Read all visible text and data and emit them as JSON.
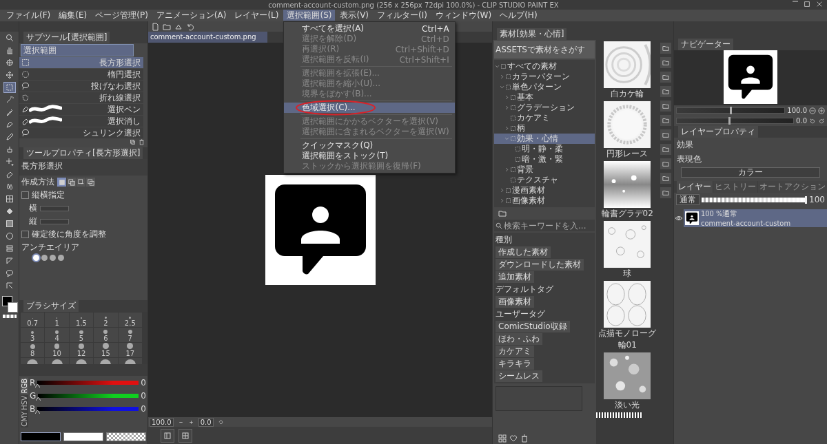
{
  "window": {
    "title": "comment-account-custom.png (256 x 256px 72dpi 100.0%) - CLIP STUDIO PAINT EX"
  },
  "menu_bar": [
    {
      "label": "ファイル(F)",
      "selected": false
    },
    {
      "label": "編集(E)",
      "selected": false
    },
    {
      "label": "ページ管理(P)",
      "selected": false
    },
    {
      "label": "アニメーション(A)",
      "selected": false
    },
    {
      "label": "レイヤー(L)",
      "selected": false
    },
    {
      "label": "選択範囲(S)",
      "selected": true
    },
    {
      "label": "表示(V)",
      "selected": false
    },
    {
      "label": "フィルター(I)",
      "selected": false
    },
    {
      "label": "ウィンドウ(W)",
      "selected": false
    },
    {
      "label": "ヘルプ(H)",
      "selected": false
    }
  ],
  "selection_menu": [
    {
      "kind": "item",
      "label": "すべてを選択(A)",
      "shortcut": "Ctrl+A",
      "disabled": false,
      "selected": false,
      "circled": false
    },
    {
      "kind": "item",
      "label": "選択を解除(D)",
      "shortcut": "Ctrl+D",
      "disabled": true,
      "selected": false,
      "circled": false
    },
    {
      "kind": "item",
      "label": "再選択(R)",
      "shortcut": "Ctrl+Shift+D",
      "disabled": true,
      "selected": false,
      "circled": false
    },
    {
      "kind": "item",
      "label": "選択範囲を反転(I)",
      "shortcut": "Ctrl+Shift+I",
      "disabled": true,
      "selected": false,
      "circled": false
    },
    {
      "kind": "separator"
    },
    {
      "kind": "item",
      "label": "選択範囲を拡張(E)...",
      "disabled": true,
      "selected": false,
      "circled": false
    },
    {
      "kind": "item",
      "label": "選択範囲を縮小(U)...",
      "disabled": true,
      "selected": false,
      "circled": false
    },
    {
      "kind": "item",
      "label": "境界をぼかす(B)...",
      "disabled": true,
      "selected": false,
      "circled": false
    },
    {
      "kind": "separator"
    },
    {
      "kind": "item",
      "label": "色域選択(C)...",
      "disabled": false,
      "selected": true,
      "circled": true
    },
    {
      "kind": "separator"
    },
    {
      "kind": "item",
      "label": "選択範囲にかかるベクターを選択(V)",
      "disabled": true,
      "selected": false,
      "circled": false
    },
    {
      "kind": "item",
      "label": "選択範囲に含まれるベクターを選択(W)",
      "disabled": true,
      "selected": false,
      "circled": false
    },
    {
      "kind": "separator"
    },
    {
      "kind": "item",
      "label": "クイックマスク(Q)",
      "disabled": false,
      "selected": false,
      "circled": false
    },
    {
      "kind": "item",
      "label": "選択範囲をストック(T)",
      "disabled": false,
      "selected": false,
      "circled": false
    },
    {
      "kind": "item",
      "label": "ストックから選択範囲を復帰(F)",
      "disabled": true,
      "selected": false,
      "circled": false
    }
  ],
  "tools": [
    {
      "kind": "zoom",
      "selected": false
    },
    {
      "kind": "hand",
      "selected": false
    },
    {
      "kind": "view",
      "selected": false
    },
    {
      "kind": "move",
      "selected": false
    },
    {
      "kind": "select",
      "selected": true
    },
    {
      "kind": "wand",
      "selected": false
    },
    {
      "kind": "eyedropper",
      "selected": false
    },
    {
      "kind": "pen",
      "selected": false
    },
    {
      "kind": "pencil",
      "selected": false
    },
    {
      "kind": "airbrush",
      "selected": false
    },
    {
      "kind": "decoration",
      "selected": false
    },
    {
      "kind": "eraser",
      "selected": false
    },
    {
      "kind": "blend",
      "selected": false
    },
    {
      "kind": "frame",
      "selected": false
    },
    {
      "kind": "fill",
      "selected": false
    },
    {
      "kind": "gradient",
      "selected": false
    },
    {
      "kind": "figure",
      "selected": false
    },
    {
      "kind": "layers",
      "selected": false
    },
    {
      "kind": "ruler",
      "selected": false
    },
    {
      "kind": "balloon",
      "selected": false
    },
    {
      "kind": "correction",
      "selected": false
    }
  ],
  "subtool": {
    "tab": "サブツール[選択範囲]",
    "group": "選択範囲",
    "items": [
      {
        "label": "長方形選択",
        "kind": "rect",
        "selected": true,
        "scribbled": false
      },
      {
        "label": "楕円選択",
        "kind": "ellipse",
        "selected": false,
        "scribbled": false
      },
      {
        "label": "投げなわ選択",
        "kind": "lasso",
        "selected": false,
        "scribbled": false
      },
      {
        "label": "折れ線選択",
        "kind": "polyline",
        "selected": false,
        "scribbled": false
      },
      {
        "label": "選択ペン",
        "kind": "pen",
        "selected": false,
        "scribbled": true
      },
      {
        "label": "選択消し",
        "kind": "eraser",
        "selected": false,
        "scribbled": true
      },
      {
        "label": "シュリンク選択",
        "kind": "lasso",
        "selected": false,
        "scribbled": false
      }
    ]
  },
  "tool_property": {
    "tab": "ツールプロパティ[長方形選択]",
    "title": "長方形選択",
    "creation_label": "作成方法",
    "creation_modes": [
      {
        "kind": "new",
        "selected": true
      },
      {
        "kind": "add",
        "selected": false
      },
      {
        "kind": "subtract",
        "selected": false
      },
      {
        "kind": "intersect",
        "selected": false
      }
    ],
    "aspect": {
      "label": "縦横指定",
      "checked": false
    },
    "width_label": "横",
    "height_label": "縦",
    "adjust_angle": {
      "label": "確定後に角度を調整",
      "checked": false
    },
    "antialias_label": "アンチエイリア",
    "antialias_levels": [
      {
        "selected": true
      },
      {
        "selected": false
      },
      {
        "selected": false
      },
      {
        "selected": false
      }
    ]
  },
  "brush_size": {
    "tab": "ブラシサイズ",
    "sizes": [
      "0.7",
      "1",
      "1.5",
      "2",
      "2.5",
      "3",
      "4",
      "5",
      "6",
      "7",
      "8",
      "10",
      "12",
      "15",
      "17"
    ]
  },
  "color_slider": {
    "modes": [
      {
        "label": "RGB",
        "selected": true
      },
      {
        "label": "HSV",
        "selected": false
      },
      {
        "label": "CMY",
        "selected": false
      }
    ],
    "channels": [
      {
        "name": "R",
        "color": "#e01010",
        "level": 0,
        "reading": "0"
      },
      {
        "name": "G",
        "color": "#10d020",
        "level": 0,
        "reading": "0"
      },
      {
        "name": "B",
        "color": "#1010e0",
        "level": 0,
        "reading": "0"
      }
    ]
  },
  "canvas": {
    "tab": "comment-account-custom.png",
    "zoom": "100.0",
    "angle": "0.0"
  },
  "materials": {
    "tab": "素材[効果・心情]",
    "assets_button": "ASSETSで素材をさがす",
    "tree": [
      {
        "label": "すべての素材",
        "expandable": true,
        "expanded": true,
        "selected": false,
        "children": [
          {
            "label": "カラーパターン",
            "expandable": true,
            "expanded": false,
            "selected": false
          },
          {
            "label": "単色パターン",
            "expandable": true,
            "expanded": true,
            "selected": false,
            "children": [
              {
                "label": "基本",
                "expandable": true,
                "expanded": false,
                "selected": false
              },
              {
                "label": "グラデーション",
                "expandable": true,
                "expanded": false,
                "selected": false
              },
              {
                "label": "カケアミ",
                "expandable": false,
                "expanded": false,
                "selected": false
              },
              {
                "label": "柄",
                "expandable": true,
                "expanded": false,
                "selected": false
              },
              {
                "label": "効果・心情",
                "expandable": true,
                "expanded": true,
                "selected": true,
                "children": [
                  {
                    "label": "明・静・柔",
                    "expandable": false,
                    "expanded": false,
                    "selected": false
                  },
                  {
                    "label": "暗・激・緊",
                    "expandable": false,
                    "expanded": false,
                    "selected": false
                  }
                ]
              },
              {
                "label": "背景",
                "expandable": true,
                "expanded": false,
                "selected": false
              },
              {
                "label": "テクスチャ",
                "expandable": false,
                "expanded": false,
                "selected": false
              }
            ]
          },
          {
            "label": "漫画素材",
            "expandable": true,
            "expanded": false,
            "selected": false
          },
          {
            "label": "画像素材",
            "expandable": true,
            "expanded": false,
            "selected": false
          }
        ]
      }
    ],
    "search_placeholder": "検索キーワードを入...",
    "tags": [
      {
        "kind": "heading",
        "label": "種別"
      },
      {
        "kind": "tag",
        "label": "作成した素材"
      },
      {
        "kind": "tag",
        "label": "ダウンロードした素材"
      },
      {
        "kind": "tag",
        "label": "追加素材"
      },
      {
        "kind": "heading",
        "label": "デフォルトタグ"
      },
      {
        "kind": "tag",
        "label": "画像素材"
      },
      {
        "kind": "heading",
        "label": "ユーザータグ"
      },
      {
        "kind": "tag",
        "label": "ComicStudio収録"
      },
      {
        "kind": "tag",
        "label": "ほわ・ふわ"
      },
      {
        "kind": "tag",
        "label": "カケアミ"
      },
      {
        "kind": "tag",
        "label": "キラキラ"
      },
      {
        "kind": "tag",
        "label": "シームレス"
      }
    ],
    "thumbnails": [
      {
        "kind": "rings",
        "caption": "白カケ輪"
      },
      {
        "kind": "lace",
        "caption": "円形レース"
      },
      {
        "kind": "gradient",
        "caption": "輪書グラデ02"
      },
      {
        "kind": "bubbles",
        "caption": "球"
      },
      {
        "kind": "frames",
        "caption": "点描モノローグ輪01"
      },
      {
        "kind": "bokeh",
        "caption": "淡い光"
      }
    ]
  },
  "navigator": {
    "tab": "ナビゲーター",
    "zoom": "100.0",
    "angle": "0.0",
    "zoom_slider": {
      "level": 0.5
    },
    "rotation_slider": {
      "level": 0.45
    }
  },
  "layer_property": {
    "tab": "レイヤープロパティ",
    "effect_label": "効果",
    "color_label": "表現色",
    "color_mode": "カラー"
  },
  "layers": {
    "tabs": [
      {
        "label": "レイヤー",
        "selected": true
      },
      {
        "label": "ヒストリー",
        "selected": false
      },
      {
        "label": "オートアクション",
        "selected": false
      }
    ],
    "blend_mode": "通常",
    "opacity": "100",
    "opacity_slider": {
      "level": 1
    },
    "items": [
      {
        "mode_text": "100 %通常",
        "name": "comment-account-custom",
        "selected": true,
        "visible": true
      }
    ]
  }
}
